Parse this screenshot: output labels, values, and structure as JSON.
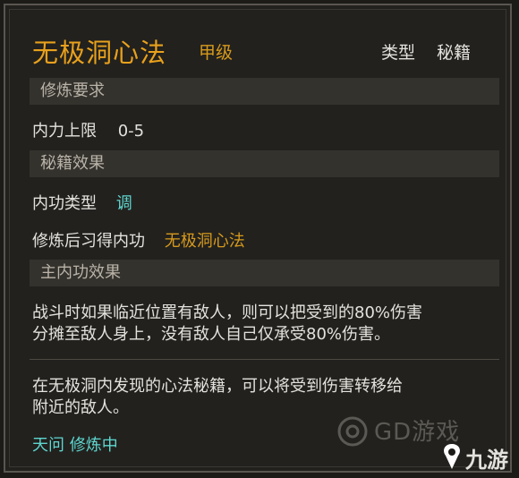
{
  "skill": {
    "name": "无极洞心法",
    "grade": "甲级",
    "type_label": "类型",
    "type_value": "秘籍"
  },
  "sections": {
    "requirement_header": "修炼要求",
    "effect_header": "秘籍效果",
    "main_effect_header": "主内功效果"
  },
  "requirement": {
    "label": "内力上限",
    "value": "0-5"
  },
  "effect": {
    "neigong_type_label": "内功类型",
    "neigong_type_value": "调",
    "acquire_label": "修炼后习得内功",
    "acquire_value": "无极洞心法"
  },
  "main_effect": {
    "line1": "战斗时如果临近位置有敌人，则可以把受到的80%伤害",
    "line2": "分摊至敌人身上，没有敌人自己仅承受80%伤害。"
  },
  "description": {
    "line1": "在无极洞内发现的心法秘籍，可以将受到伤害转移给",
    "line2": "附近的敌人。"
  },
  "status": "天问 修炼中",
  "watermark": {
    "text": "GD游戏",
    "brand": "九游"
  },
  "colors": {
    "title": "#e8a11c",
    "cyan": "#5fd6cf",
    "section_bg": "#34322d"
  }
}
